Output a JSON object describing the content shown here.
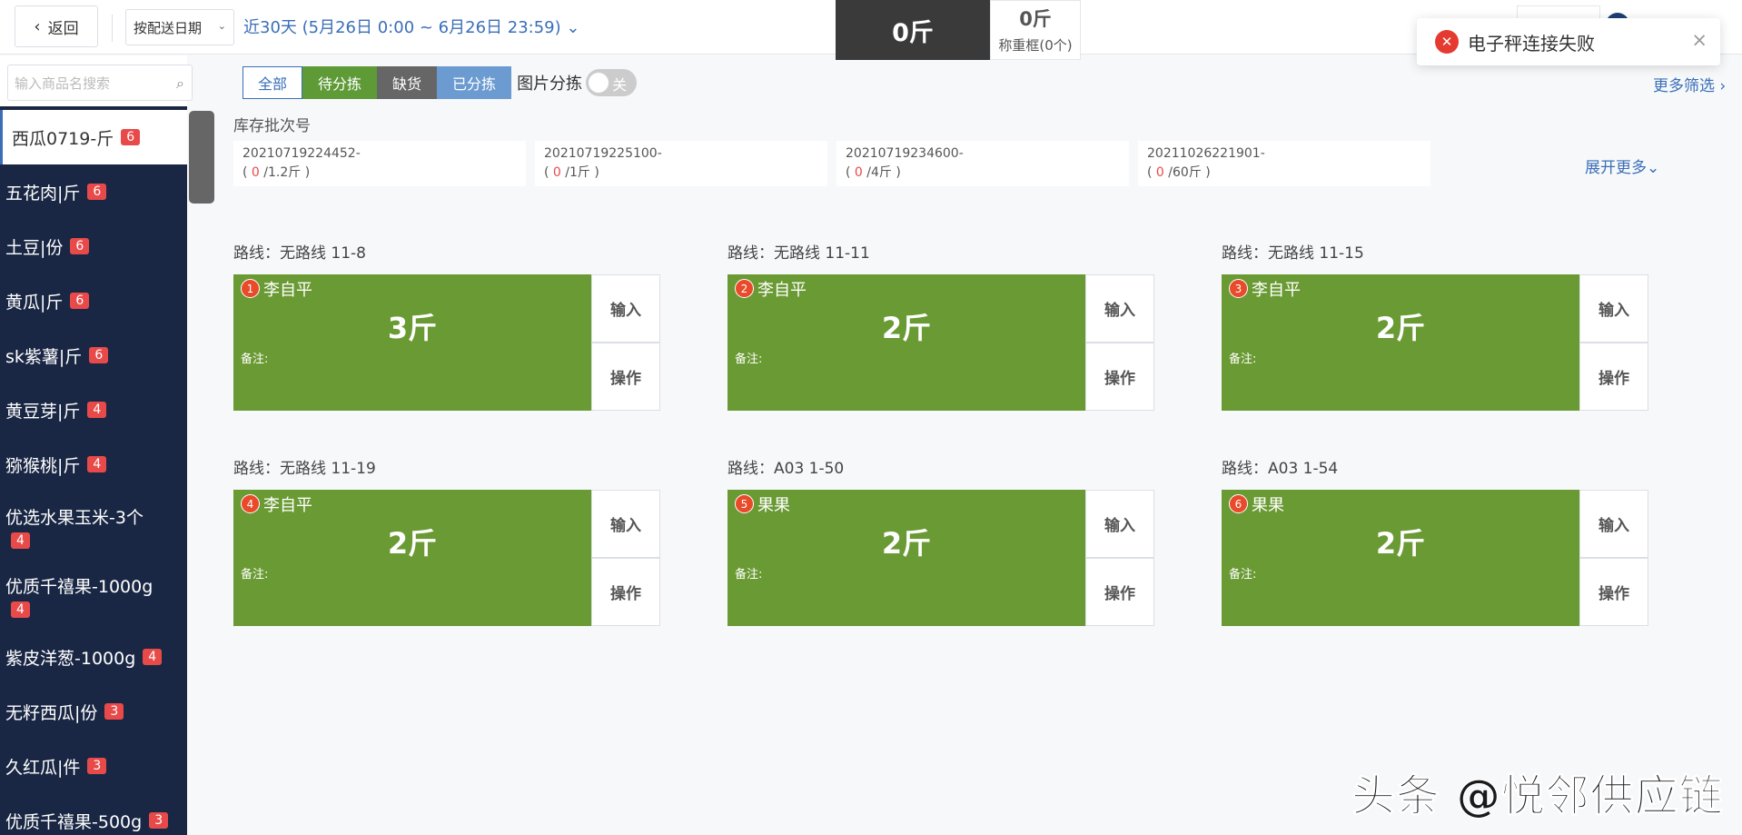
{
  "header": {
    "back_label": "返回",
    "date_type": "按配送日期",
    "date_range": "近30天 (5月26日 0:00 ~ 6月26日 23:59)",
    "current_weight": "0斤",
    "tare_weight": "0斤",
    "tare_label": "称重框(0个)"
  },
  "toast": {
    "message": "电子秤连接失败",
    "icon": "error-icon"
  },
  "sidebar": {
    "search_placeholder": "输入商品名搜索",
    "items": [
      {
        "name": "西瓜0719-斤",
        "count": "6"
      },
      {
        "name": "五花肉|斤",
        "count": "6"
      },
      {
        "name": "土豆|份",
        "count": "6"
      },
      {
        "name": "黄瓜|斤",
        "count": "6"
      },
      {
        "name": "sk紫薯|斤",
        "count": "6"
      },
      {
        "name": "黄豆芽|斤",
        "count": "4"
      },
      {
        "name": "猕猴桃|斤",
        "count": "4"
      },
      {
        "name": "优选水果玉米-3个",
        "count": "4"
      },
      {
        "name": "优质千禧果-1000g",
        "count": "4"
      },
      {
        "name": "紫皮洋葱-1000g",
        "count": "4"
      },
      {
        "name": "无籽西瓜|份",
        "count": "3"
      },
      {
        "name": "久红瓜|件",
        "count": "3"
      },
      {
        "name": "优质千禧果-500g",
        "count": "3"
      }
    ]
  },
  "filters": {
    "all": "全部",
    "waiting": "待分拣",
    "shortage": "缺货",
    "sorted": "已分拣",
    "pic_sort": "图片分拣",
    "toggle": "关",
    "more": "更多筛选"
  },
  "batch": {
    "title": "库存批次号",
    "expand": "展开更多",
    "items": [
      {
        "id": "20210719224452-",
        "used": "0",
        "total": "/1.2斤 )"
      },
      {
        "id": "20210719225100-",
        "used": "0",
        "total": "/1斤 )"
      },
      {
        "id": "20210719234600-",
        "used": "0",
        "total": "/4斤 )"
      },
      {
        "id": "20211026221901-",
        "used": "0",
        "total": "/60斤 )"
      }
    ]
  },
  "tasks": [
    {
      "route": "路线：无路线 11-8",
      "num": "1",
      "name": "李自平",
      "weight": "3斤",
      "note": "备注:",
      "input": "输入",
      "op": "操作"
    },
    {
      "route": "路线：无路线 11-11",
      "num": "2",
      "name": "李自平",
      "weight": "2斤",
      "note": "备注:",
      "input": "输入",
      "op": "操作"
    },
    {
      "route": "路线：无路线 11-15",
      "num": "3",
      "name": "李自平",
      "weight": "2斤",
      "note": "备注:",
      "input": "输入",
      "op": "操作"
    },
    {
      "route": "路线：无路线 11-19",
      "num": "4",
      "name": "李自平",
      "weight": "2斤",
      "note": "备注:",
      "input": "输入",
      "op": "操作"
    },
    {
      "route": "路线：A03 1-50",
      "num": "5",
      "name": "果果",
      "weight": "2斤",
      "note": "备注:",
      "input": "输入",
      "op": "操作"
    },
    {
      "route": "路线：A03 1-54",
      "num": "6",
      "name": "果果",
      "weight": "2斤",
      "note": "备注:",
      "input": "输入",
      "op": "操作"
    }
  ],
  "watermark": "头条 @悦邻供应链",
  "colors": {
    "accent": "#3a6fb8",
    "task_green": "#6a9a33",
    "sidebar": "#1a2744",
    "badge": "#e84a4a"
  }
}
